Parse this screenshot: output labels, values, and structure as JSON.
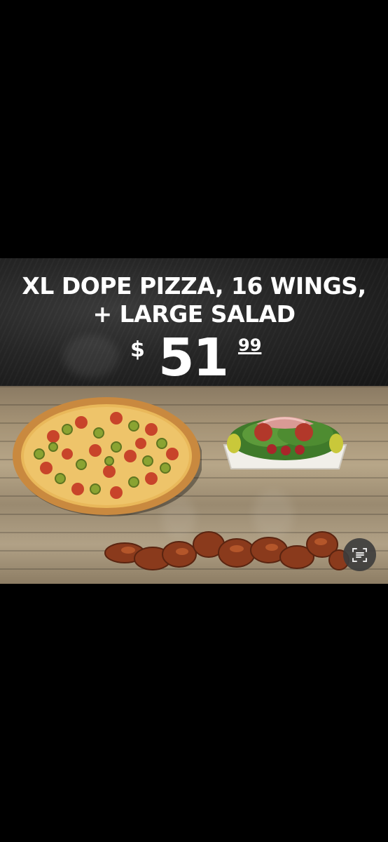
{
  "ad": {
    "headline_line1": "XL DOPE PIZZA, 16 WINGS,",
    "headline_line2": "+ LARGE SALAD",
    "price_currency": "$",
    "price_dollars": "51",
    "price_cents": "99"
  },
  "images": {
    "pizza": "pizza-image",
    "salad": "salad-image",
    "wings": "wings-image"
  },
  "viewer": {
    "lens_button_icon": "scan-text-icon"
  }
}
